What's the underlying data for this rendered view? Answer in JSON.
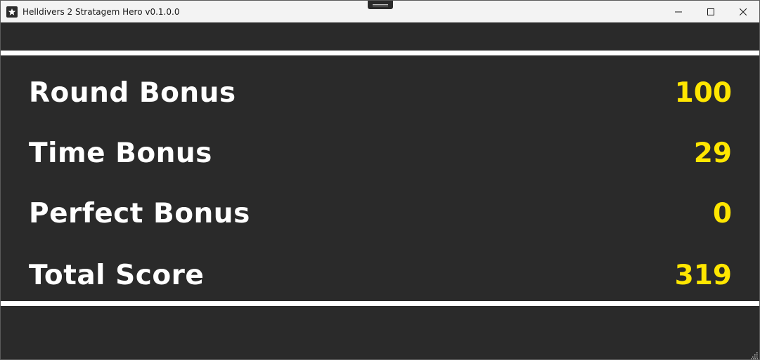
{
  "window": {
    "title": "Helldivers 2 Stratagem Hero v0.1.0.0",
    "app_icon": "star-icon",
    "controls": {
      "minimize_icon": "minimize-icon",
      "maximize_icon": "maximize-icon",
      "close_icon": "close-icon"
    }
  },
  "colors": {
    "background": "#2a2a2a",
    "label": "#ffffff",
    "value": "#ffe600",
    "rule": "#ffffff"
  },
  "scores": [
    {
      "label": "Round Bonus",
      "value": "100"
    },
    {
      "label": "Time Bonus",
      "value": "29"
    },
    {
      "label": "Perfect Bonus",
      "value": "0"
    },
    {
      "label": "Total Score",
      "value": "319"
    }
  ]
}
